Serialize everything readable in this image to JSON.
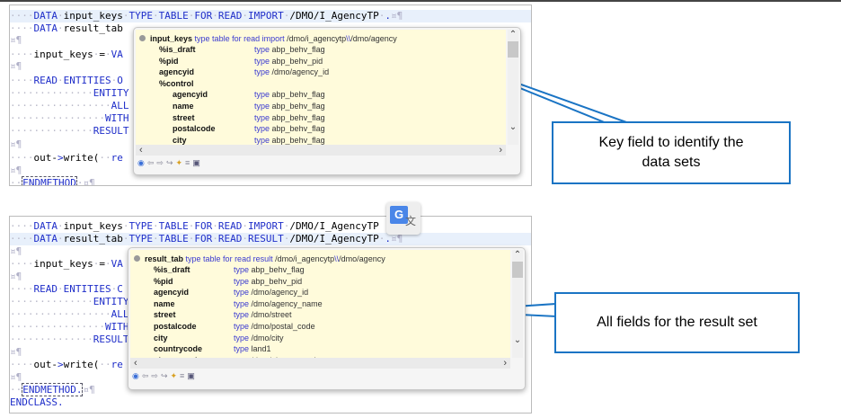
{
  "top": {
    "code_lines": [
      [
        "····DATA·input_keys·TYPE·TABLE·FOR·READ·IMPORT·/DMO/I_AgencyTP·.",
        "¤¶"
      ],
      [
        "····DATA·result_tab",
        ""
      ],
      [
        "",
        "¤¶"
      ],
      [
        "····input_keys·=·VA",
        ""
      ],
      [
        "",
        "¤¶"
      ],
      [
        "····READ·ENTITIES·O",
        ""
      ],
      [
        "··············ENTITY",
        ""
      ],
      [
        "·················ALL",
        ""
      ],
      [
        "················WITH",
        ""
      ],
      [
        "··············RESULT",
        ""
      ],
      [
        "",
        "¤¶"
      ],
      [
        "····out->write(··re",
        ""
      ],
      [
        "",
        "¤¶"
      ],
      [
        "··ENDMETHOD",
        "·¤¶"
      ]
    ],
    "popup": {
      "header_name": "input_keys",
      "header_kw": "type table for read import",
      "header_path1": "/dmo/i_agencytp",
      "header_sep": "\\\\",
      "header_path2": "/dmo/agency",
      "type_kw": "type",
      "rows": [
        {
          "name": "%is_draft",
          "type": "abp_behv_flag",
          "indent": 1
        },
        {
          "name": "%pid",
          "type": "abp_behv_pid",
          "indent": 1
        },
        {
          "name": "agencyid",
          "type": "/dmo/agency_id",
          "indent": 1
        },
        {
          "name": "%control",
          "type": "",
          "indent": 1
        },
        {
          "name": "agencyid",
          "type": "abp_behv_flag",
          "indent": 2
        },
        {
          "name": "name",
          "type": "abp_behv_flag",
          "indent": 2
        },
        {
          "name": "street",
          "type": "abp_behv_flag",
          "indent": 2
        },
        {
          "name": "postalcode",
          "type": "abp_behv_flag",
          "indent": 2
        },
        {
          "name": "city",
          "type": "abp_behv_flag",
          "indent": 2
        }
      ]
    },
    "callout": "Key field to identify the data sets"
  },
  "bottom": {
    "code_lines": [
      [
        "····DATA·input_keys·TYPE·TABLE·FOR·READ·IMPORT·/DMO/I_AgencyTP",
        ""
      ],
      [
        "····DATA·result_tab·TYPE·TABLE·FOR·READ·RESULT·/DMO/I_AgencyTP·.",
        "¤¶"
      ],
      [
        "",
        "¤¶"
      ],
      [
        "····input_keys·=·VA",
        ""
      ],
      [
        "",
        "¤¶"
      ],
      [
        "····READ·ENTITIES·C",
        ""
      ],
      [
        "··············ENTITY",
        ""
      ],
      [
        "·················ALL",
        ""
      ],
      [
        "················WITH",
        ""
      ],
      [
        "··············RESULT",
        ""
      ],
      [
        "",
        "¤¶"
      ],
      [
        "····out->write(··re",
        ""
      ],
      [
        "",
        "¤¶"
      ],
      [
        "··ENDMETHOD.",
        "¤¶"
      ],
      [
        "ENDCLASS.",
        ""
      ]
    ],
    "popup": {
      "header_name": "result_tab",
      "header_kw": "type table for read result",
      "header_path1": "/dmo/i_agencytp",
      "header_sep": "\\\\",
      "header_path2": "/dmo/agency",
      "type_kw": "type",
      "rows": [
        {
          "name": "%is_draft",
          "type": "abp_behv_flag",
          "indent": 1
        },
        {
          "name": "%pid",
          "type": "abp_behv_pid",
          "indent": 1
        },
        {
          "name": "agencyid",
          "type": "/dmo/agency_id",
          "indent": 1
        },
        {
          "name": "name",
          "type": "/dmo/agency_name",
          "indent": 1
        },
        {
          "name": "street",
          "type": "/dmo/street",
          "indent": 1
        },
        {
          "name": "postalcode",
          "type": "/dmo/postal_code",
          "indent": 1
        },
        {
          "name": "city",
          "type": "/dmo/city",
          "indent": 1
        },
        {
          "name": "countrycode",
          "type": "land1",
          "indent": 1
        },
        {
          "name": "phonenumber",
          "type": "/dmo/phone_number",
          "indent": 1
        }
      ]
    },
    "callout": "All fields for the result set",
    "translate_icon": "google-translate-icon"
  },
  "colors": {
    "accent": "#1a74c4",
    "keyword": "#1f2ec9",
    "popup_bg": "#fffbdb"
  }
}
